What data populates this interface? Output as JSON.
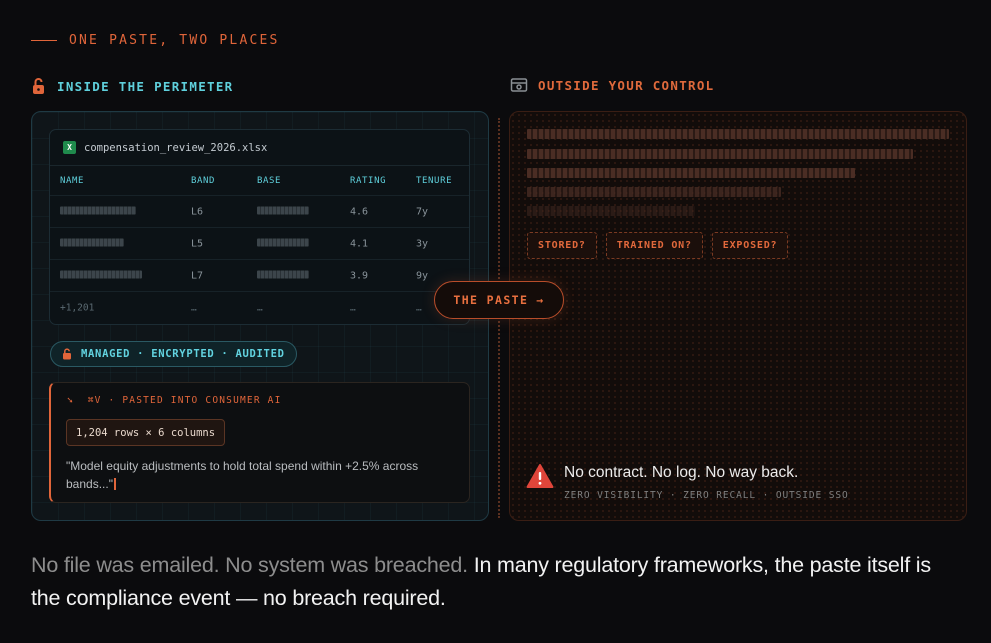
{
  "eyebrow": "ONE PASTE, TWO PLACES",
  "left": {
    "heading": "INSIDE THE PERIMETER",
    "heading_icon": "lock-icon",
    "file_name": "compensation_review_2026.xlsx",
    "file_icon": "excel-icon",
    "columns": [
      "NAME",
      "BAND",
      "BASE",
      "RATING",
      "TENURE"
    ],
    "rows": [
      {
        "band": "L6",
        "rating": "4.6",
        "tenure": "7y"
      },
      {
        "band": "L5",
        "rating": "4.1",
        "tenure": "3y"
      },
      {
        "band": "L7",
        "rating": "3.9",
        "tenure": "9y"
      }
    ],
    "more_row": {
      "count": "+1,201",
      "band": "…",
      "base": "…",
      "rating": "…",
      "tenure": "…"
    },
    "badge": "MANAGED · ENCRYPTED · AUDITED",
    "paste_label": "⌘V · PASTED INTO CONSUMER AI",
    "rows_chip": "1,204 rows × 6 columns",
    "quote": "\"Model equity adjustments to hold total spend within +2.5% across bands...\""
  },
  "paste_button": {
    "label": "THE PASTE",
    "arrow": "→"
  },
  "right": {
    "heading": "OUTSIDE YOUR CONTROL",
    "heading_icon": "server-icon",
    "tags": [
      "STORED?",
      "TRAINED ON?",
      "EXPOSED?"
    ],
    "warning_title": "No contract. No log. No way back.",
    "warning_sub": "ZERO VISIBILITY · ZERO RECALL · OUTSIDE SSO",
    "warning_icon": "warning-triangle-icon"
  },
  "footer": {
    "dim": "No file was emailed. No system was breached.",
    "bright": "In many regulatory frameworks, the paste itself is the compliance event — no breach required."
  },
  "colors": {
    "accent_orange": "#e0653a",
    "accent_cyan": "#5fd0dc",
    "background": "#0b0b0d"
  }
}
